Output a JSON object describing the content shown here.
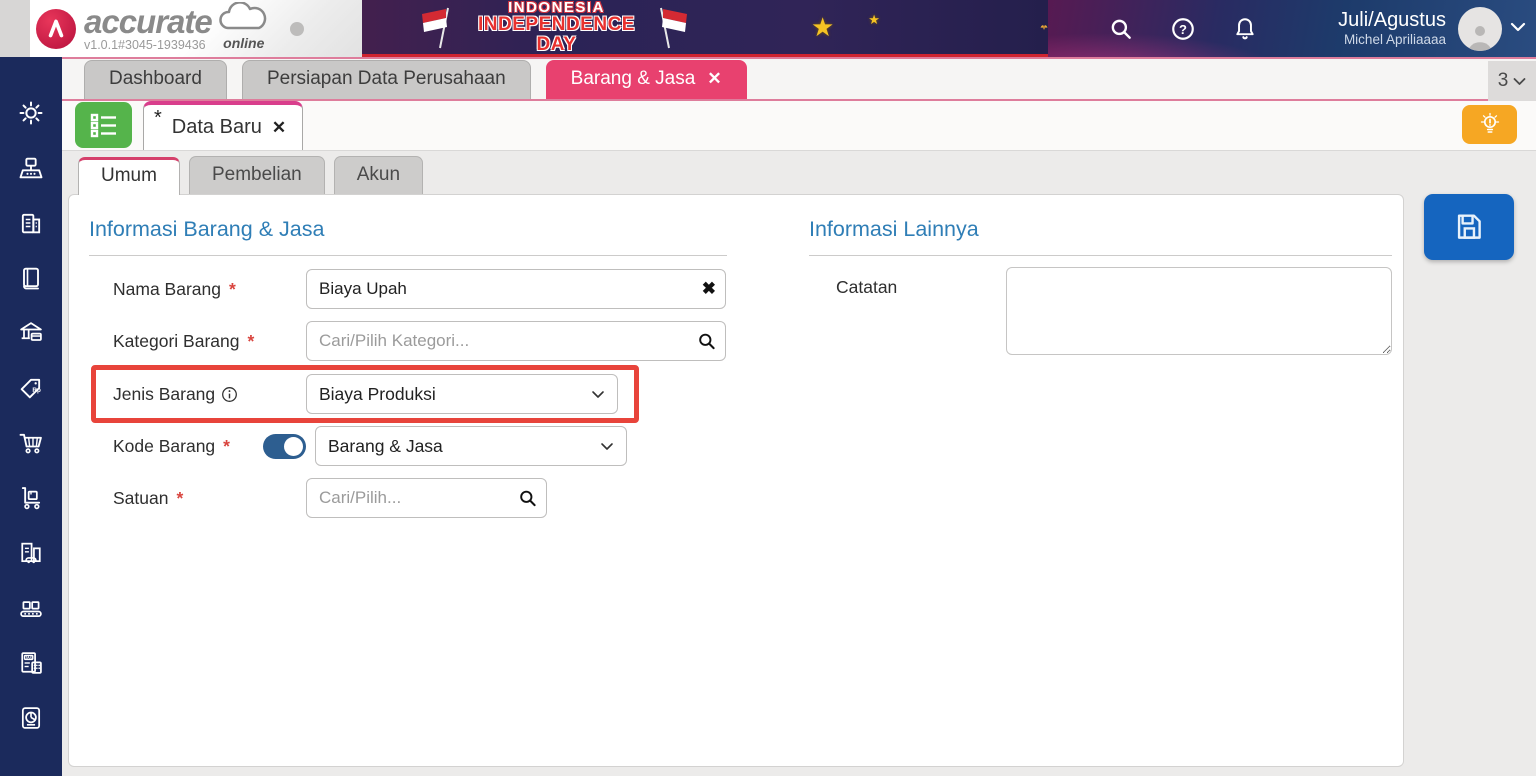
{
  "header": {
    "brand": "accurate",
    "brand_sub": "online",
    "version": "v1.0.1#3045-1939436",
    "banner_line1": "INDONESIA",
    "banner_line2": "INDEPENDENCE DAY",
    "user_period": "Juli/Agustus",
    "user_name": "Michel Apriliaaaa"
  },
  "main_tabs": [
    {
      "label": "Dashboard",
      "active": false
    },
    {
      "label": "Persiapan Data Perusahaan",
      "active": false
    },
    {
      "label": "Barang & Jasa",
      "active": true,
      "closable": true
    }
  ],
  "tab_overflow_count": "3",
  "doc_tab": {
    "dirty_marker": "*",
    "label": "Data Baru"
  },
  "sub_tabs": [
    {
      "label": "Umum",
      "active": true
    },
    {
      "label": "Pembelian",
      "active": false
    },
    {
      "label": "Akun",
      "active": false
    }
  ],
  "form": {
    "section_left_title": "Informasi Barang & Jasa",
    "section_right_title": "Informasi Lainnya",
    "required_marker": "*",
    "nama_barang": {
      "label": "Nama Barang",
      "value": "Biaya Upah"
    },
    "kategori_barang": {
      "label": "Kategori Barang",
      "placeholder": "Cari/Pilih Kategori..."
    },
    "jenis_barang": {
      "label": "Jenis Barang",
      "value": "Biaya Produksi",
      "highlighted": true
    },
    "kode_barang": {
      "label": "Kode Barang",
      "value": "Barang & Jasa",
      "toggle_on": true
    },
    "satuan": {
      "label": "Satuan",
      "placeholder": "Cari/Pilih..."
    },
    "catatan": {
      "label": "Catatan",
      "value": ""
    }
  },
  "glyphs": {
    "close": "✕",
    "clear": "✖",
    "star": "★"
  },
  "sidebar_items": [
    "settings",
    "sales-register",
    "company",
    "journal",
    "banking",
    "pricing-rp",
    "purchases-cart",
    "inventory-trolley",
    "fixed-asset",
    "manufacture",
    "tax",
    "reports"
  ],
  "colors": {
    "accent_pink": "#E8416F",
    "sidebar_navy": "#1B2A5C",
    "header_navy": "#1D3B6B",
    "button_green": "#55B44B",
    "button_amber": "#F6A723",
    "button_blue": "#1565BF",
    "heading_blue": "#2F7EB6",
    "highlight_red": "#E8443B",
    "required_red": "#D9453F",
    "toggle_blue": "#2D5E90"
  }
}
